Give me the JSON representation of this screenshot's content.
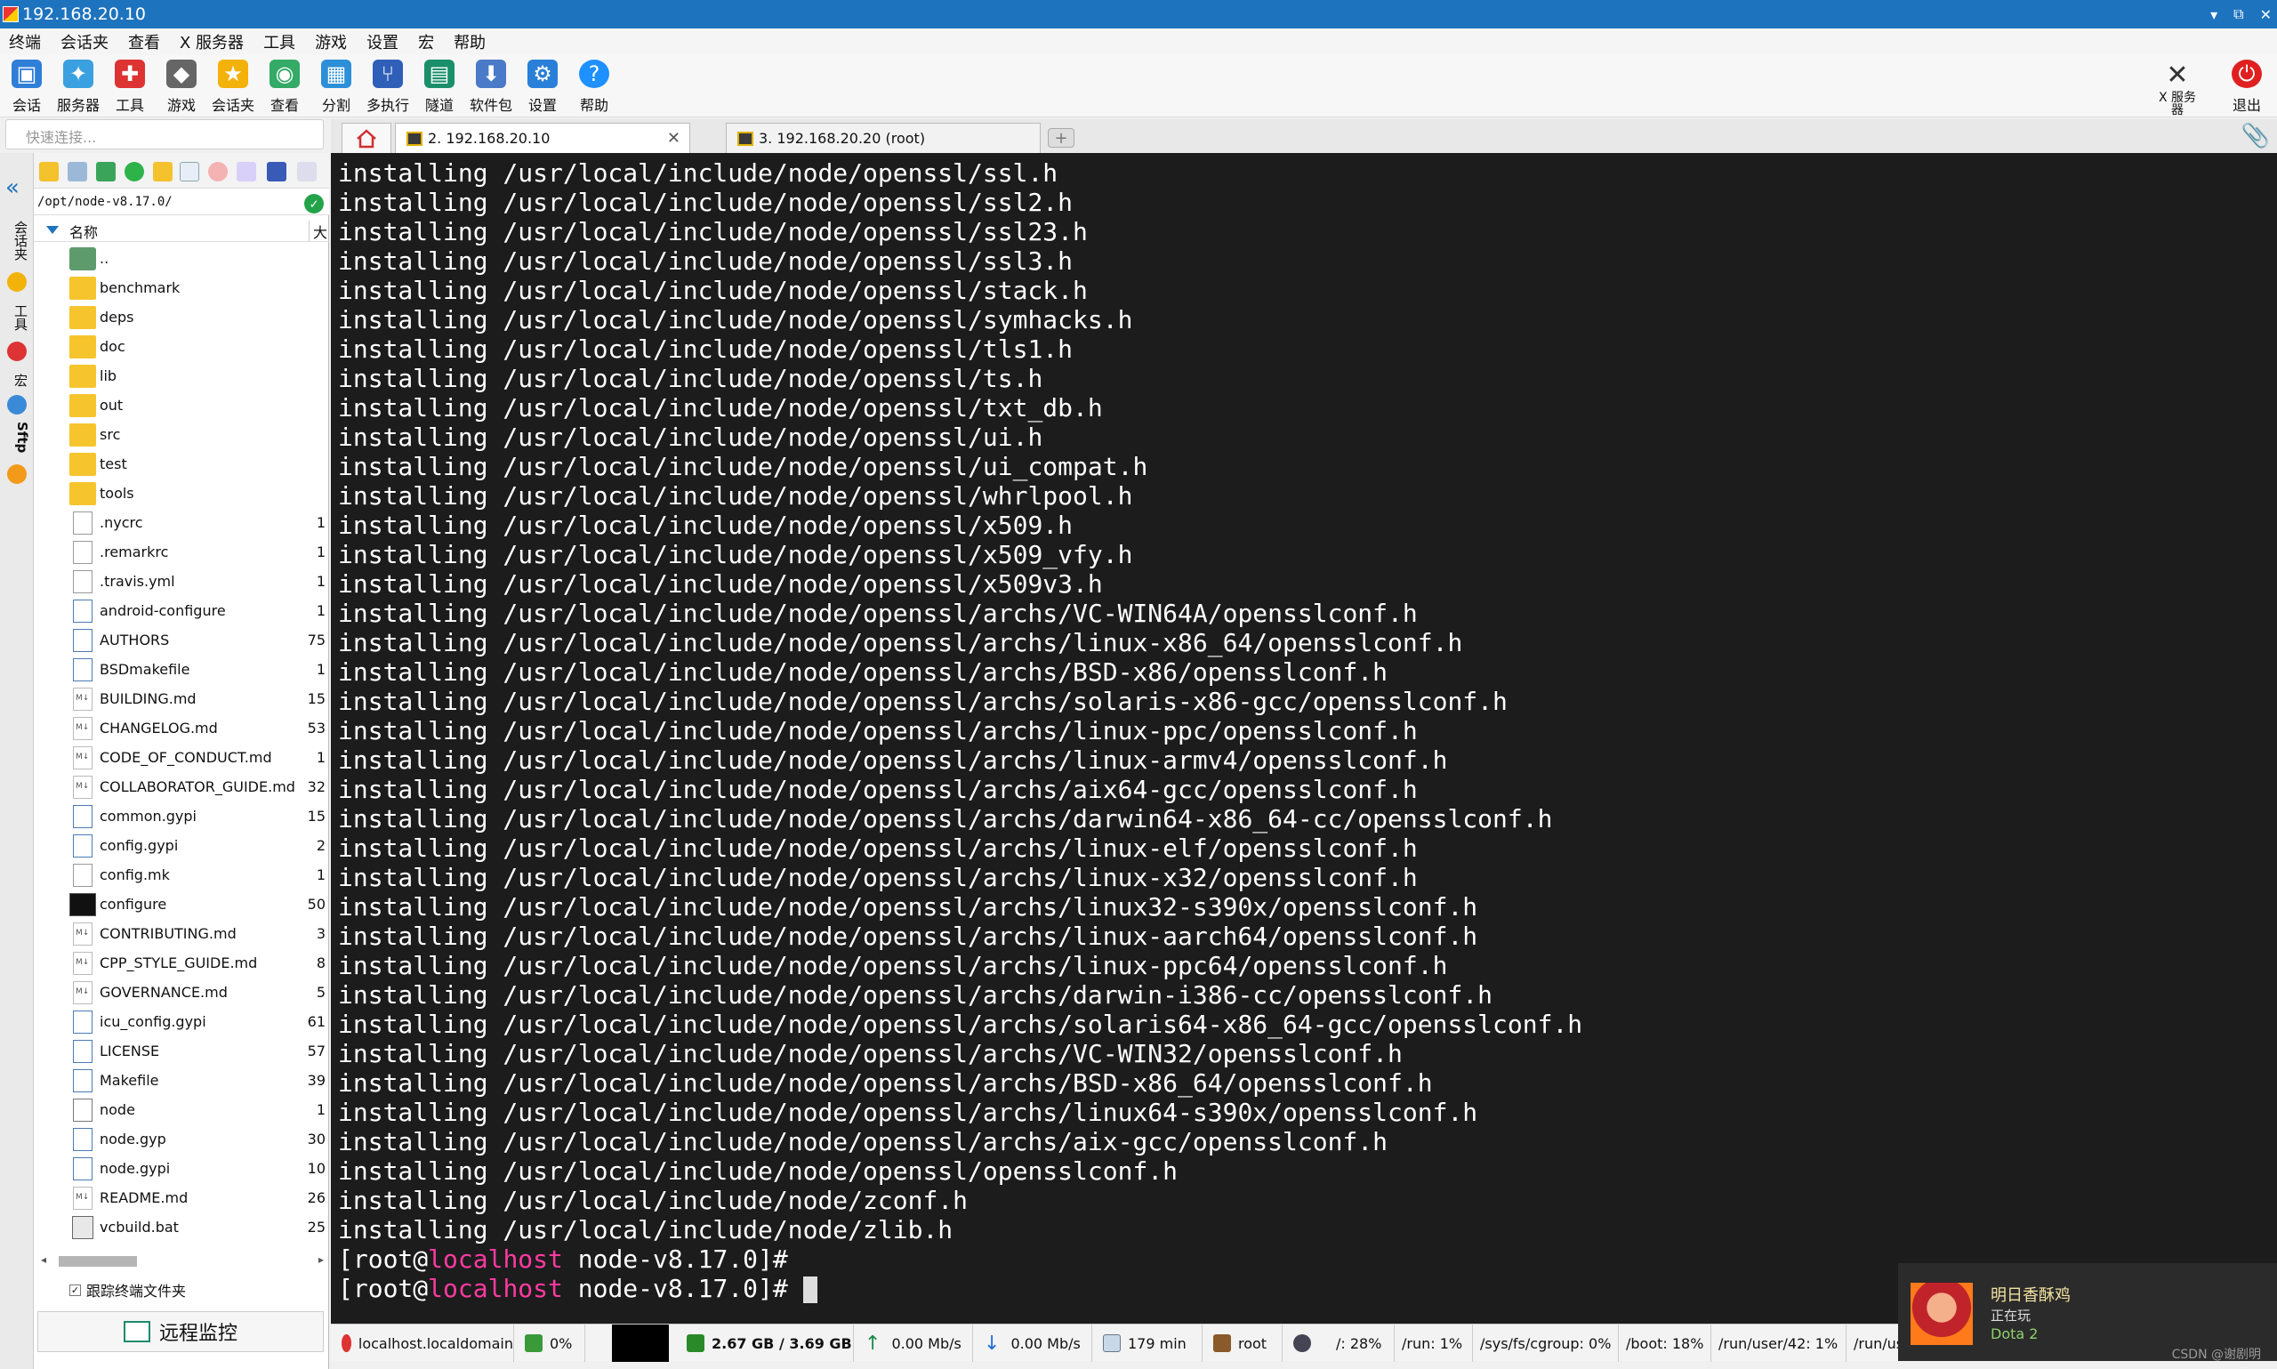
{
  "window": {
    "title": "192.168.20.10"
  },
  "menu": [
    "终端",
    "会话夹",
    "查看",
    "X 服务器",
    "工具",
    "游戏",
    "设置",
    "宏",
    "帮助"
  ],
  "toolbar": {
    "buttons": [
      {
        "label": "会话",
        "icon": "session-icon",
        "color": "#2f7fd8"
      },
      {
        "label": "服务器",
        "icon": "servers-icon",
        "color": "#3aa0e0"
      },
      {
        "label": "工具",
        "icon": "tools-icon",
        "color": "#d33"
      },
      {
        "label": "游戏",
        "icon": "games-icon",
        "color": "#666"
      },
      {
        "label": "会话夹",
        "icon": "star-icon",
        "color": "#f3b20a"
      },
      {
        "label": "查看",
        "icon": "view-icon",
        "color": "#3a6"
      },
      {
        "label": "分割",
        "icon": "split-icon",
        "color": "#2c8fd8"
      },
      {
        "label": "多执行",
        "icon": "multiexec-icon",
        "color": "#2f5fb8"
      },
      {
        "label": "隧道",
        "icon": "tunnel-icon",
        "color": "#1b8f6a"
      },
      {
        "label": "软件包",
        "icon": "package-icon",
        "color": "#4a7ac8"
      },
      {
        "label": "设置",
        "icon": "gear-icon",
        "color": "#2a7fd8"
      },
      {
        "label": "帮助",
        "icon": "help-icon",
        "color": "#1e90ff"
      }
    ],
    "xserver_label": "X 服务\n器",
    "exit_label": "退出"
  },
  "quick_connect": {
    "placeholder": "快速连接..."
  },
  "tabs": [
    {
      "label": "2. 192.168.20.10",
      "active": true
    },
    {
      "label": "3. 192.168.20.20 (root)",
      "active": false
    }
  ],
  "side_strip": [
    "会话夹",
    "工具",
    "宏",
    "Sftp"
  ],
  "sftp": {
    "path": "/opt/node-v8.17.0/",
    "col_name": "名称",
    "col_size": "大",
    "files": [
      {
        "name": "..",
        "type": "up",
        "size": ""
      },
      {
        "name": "benchmark",
        "type": "folder",
        "size": ""
      },
      {
        "name": "deps",
        "type": "folder",
        "size": ""
      },
      {
        "name": "doc",
        "type": "folder",
        "size": ""
      },
      {
        "name": "lib",
        "type": "folder",
        "size": ""
      },
      {
        "name": "out",
        "type": "folder",
        "size": ""
      },
      {
        "name": "src",
        "type": "folder",
        "size": ""
      },
      {
        "name": "test",
        "type": "folder",
        "size": ""
      },
      {
        "name": "tools",
        "type": "folder",
        "size": ""
      },
      {
        "name": ".nycrc",
        "type": "file",
        "size": "1"
      },
      {
        "name": ".remarkrc",
        "type": "file",
        "size": "1"
      },
      {
        "name": ".travis.yml",
        "type": "file",
        "size": "1"
      },
      {
        "name": "android-configure",
        "type": "text",
        "size": "1"
      },
      {
        "name": "AUTHORS",
        "type": "text",
        "size": "75"
      },
      {
        "name": "BSDmakefile",
        "type": "text",
        "size": "1"
      },
      {
        "name": "BUILDING.md",
        "type": "md",
        "size": "15"
      },
      {
        "name": "CHANGELOG.md",
        "type": "md",
        "size": "53"
      },
      {
        "name": "CODE_OF_CONDUCT.md",
        "type": "md",
        "size": "1"
      },
      {
        "name": "COLLABORATOR_GUIDE.md",
        "type": "md",
        "size": "32"
      },
      {
        "name": "common.gypi",
        "type": "text",
        "size": "15"
      },
      {
        "name": "config.gypi",
        "type": "text",
        "size": "2"
      },
      {
        "name": "config.mk",
        "type": "file",
        "size": "1"
      },
      {
        "name": "configure",
        "type": "term",
        "size": "50"
      },
      {
        "name": "CONTRIBUTING.md",
        "type": "md",
        "size": "3"
      },
      {
        "name": "CPP_STYLE_GUIDE.md",
        "type": "md",
        "size": "8"
      },
      {
        "name": "GOVERNANCE.md",
        "type": "md",
        "size": "5"
      },
      {
        "name": "icu_config.gypi",
        "type": "text",
        "size": "61"
      },
      {
        "name": "LICENSE",
        "type": "text",
        "size": "57"
      },
      {
        "name": "Makefile",
        "type": "text",
        "size": "39"
      },
      {
        "name": "node",
        "type": "link",
        "size": "1"
      },
      {
        "name": "node.gyp",
        "type": "text",
        "size": "30"
      },
      {
        "name": "node.gypi",
        "type": "text",
        "size": "10"
      },
      {
        "name": "README.md",
        "type": "md",
        "size": "26"
      },
      {
        "name": "vcbuild.bat",
        "type": "bat",
        "size": "25"
      }
    ],
    "follow_terminal": "跟踪终端文件夹",
    "monitor_button": "远程监控"
  },
  "terminal": {
    "lines": [
      "installing /usr/local/include/node/openssl/ssl.h",
      "installing /usr/local/include/node/openssl/ssl2.h",
      "installing /usr/local/include/node/openssl/ssl23.h",
      "installing /usr/local/include/node/openssl/ssl3.h",
      "installing /usr/local/include/node/openssl/stack.h",
      "installing /usr/local/include/node/openssl/symhacks.h",
      "installing /usr/local/include/node/openssl/tls1.h",
      "installing /usr/local/include/node/openssl/ts.h",
      "installing /usr/local/include/node/openssl/txt_db.h",
      "installing /usr/local/include/node/openssl/ui.h",
      "installing /usr/local/include/node/openssl/ui_compat.h",
      "installing /usr/local/include/node/openssl/whrlpool.h",
      "installing /usr/local/include/node/openssl/x509.h",
      "installing /usr/local/include/node/openssl/x509_vfy.h",
      "installing /usr/local/include/node/openssl/x509v3.h",
      "installing /usr/local/include/node/openssl/archs/VC-WIN64A/opensslconf.h",
      "installing /usr/local/include/node/openssl/archs/linux-x86_64/opensslconf.h",
      "installing /usr/local/include/node/openssl/archs/BSD-x86/opensslconf.h",
      "installing /usr/local/include/node/openssl/archs/solaris-x86-gcc/opensslconf.h",
      "installing /usr/local/include/node/openssl/archs/linux-ppc/opensslconf.h",
      "installing /usr/local/include/node/openssl/archs/linux-armv4/opensslconf.h",
      "installing /usr/local/include/node/openssl/archs/aix64-gcc/opensslconf.h",
      "installing /usr/local/include/node/openssl/archs/darwin64-x86_64-cc/opensslconf.h",
      "installing /usr/local/include/node/openssl/archs/linux-elf/opensslconf.h",
      "installing /usr/local/include/node/openssl/archs/linux-x32/opensslconf.h",
      "installing /usr/local/include/node/openssl/archs/linux32-s390x/opensslconf.h",
      "installing /usr/local/include/node/openssl/archs/linux-aarch64/opensslconf.h",
      "installing /usr/local/include/node/openssl/archs/linux-ppc64/opensslconf.h",
      "installing /usr/local/include/node/openssl/archs/darwin-i386-cc/opensslconf.h",
      "installing /usr/local/include/node/openssl/archs/solaris64-x86_64-gcc/opensslconf.h",
      "installing /usr/local/include/node/openssl/archs/VC-WIN32/opensslconf.h",
      "installing /usr/local/include/node/openssl/archs/BSD-x86_64/opensslconf.h",
      "installing /usr/local/include/node/openssl/archs/linux64-s390x/opensslconf.h",
      "installing /usr/local/include/node/openssl/archs/aix-gcc/opensslconf.h",
      "installing /usr/local/include/node/openssl/opensslconf.h",
      "installing /usr/local/include/node/zconf.h",
      "installing /usr/local/include/node/zlib.h"
    ],
    "prompt_user": "root",
    "prompt_host": "localhost",
    "prompt_dir": "node-v8.17.0"
  },
  "statusbar": {
    "hostname": "localhost.localdomain",
    "cpu": "0%",
    "memory": "2.67 GB / 3.69 GB",
    "upload": "0.00 Mb/s",
    "download": "0.00 Mb/s",
    "uptime": "179 min",
    "user": "root",
    "disk_root": "/: 28%",
    "disk_run": "/run: 1%",
    "disk_cgroup": "/sys/fs/cgroup: 0%",
    "disk_boot": "/boot: 18%",
    "disk_runuser": "/run/user/42: 1%",
    "disk_more": "/run/use"
  },
  "notification": {
    "title": "明日香酥鸡",
    "status": "正在玩",
    "game": "Dota 2"
  },
  "watermark": "CSDN @谢剧明"
}
